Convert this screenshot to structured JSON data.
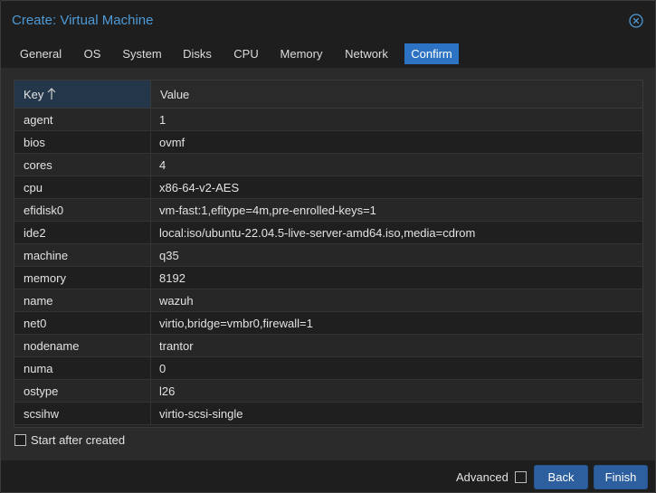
{
  "dialog": {
    "title": "Create: Virtual Machine",
    "close_icon": "close-circle-icon"
  },
  "tabs": [
    {
      "label": "General"
    },
    {
      "label": "OS"
    },
    {
      "label": "System"
    },
    {
      "label": "Disks"
    },
    {
      "label": "CPU"
    },
    {
      "label": "Memory"
    },
    {
      "label": "Network"
    },
    {
      "label": "Confirm",
      "active": true
    }
  ],
  "grid": {
    "columns": {
      "key": "Key",
      "value": "Value"
    },
    "sort_icon": "arrow-up-icon",
    "rows": [
      {
        "key": "agent",
        "value": "1"
      },
      {
        "key": "bios",
        "value": "ovmf"
      },
      {
        "key": "cores",
        "value": "4"
      },
      {
        "key": "cpu",
        "value": "x86-64-v2-AES"
      },
      {
        "key": "efidisk0",
        "value": "vm-fast:1,efitype=4m,pre-enrolled-keys=1"
      },
      {
        "key": "ide2",
        "value": "local:iso/ubuntu-22.04.5-live-server-amd64.iso,media=cdrom"
      },
      {
        "key": "machine",
        "value": "q35"
      },
      {
        "key": "memory",
        "value": "8192"
      },
      {
        "key": "name",
        "value": "wazuh"
      },
      {
        "key": "net0",
        "value": "virtio,bridge=vmbr0,firewall=1"
      },
      {
        "key": "nodename",
        "value": "trantor"
      },
      {
        "key": "numa",
        "value": "0"
      },
      {
        "key": "ostype",
        "value": "l26"
      },
      {
        "key": "scsihw",
        "value": "virtio-scsi-single"
      }
    ]
  },
  "options": {
    "start_after_created_label": "Start after created",
    "start_after_created_checked": false
  },
  "footer": {
    "advanced_label": "Advanced",
    "advanced_checked": false,
    "back_label": "Back",
    "finish_label": "Finish"
  },
  "colors": {
    "accent": "#2d73c4",
    "title": "#4e9ad6",
    "button": "#2d5f9e"
  }
}
